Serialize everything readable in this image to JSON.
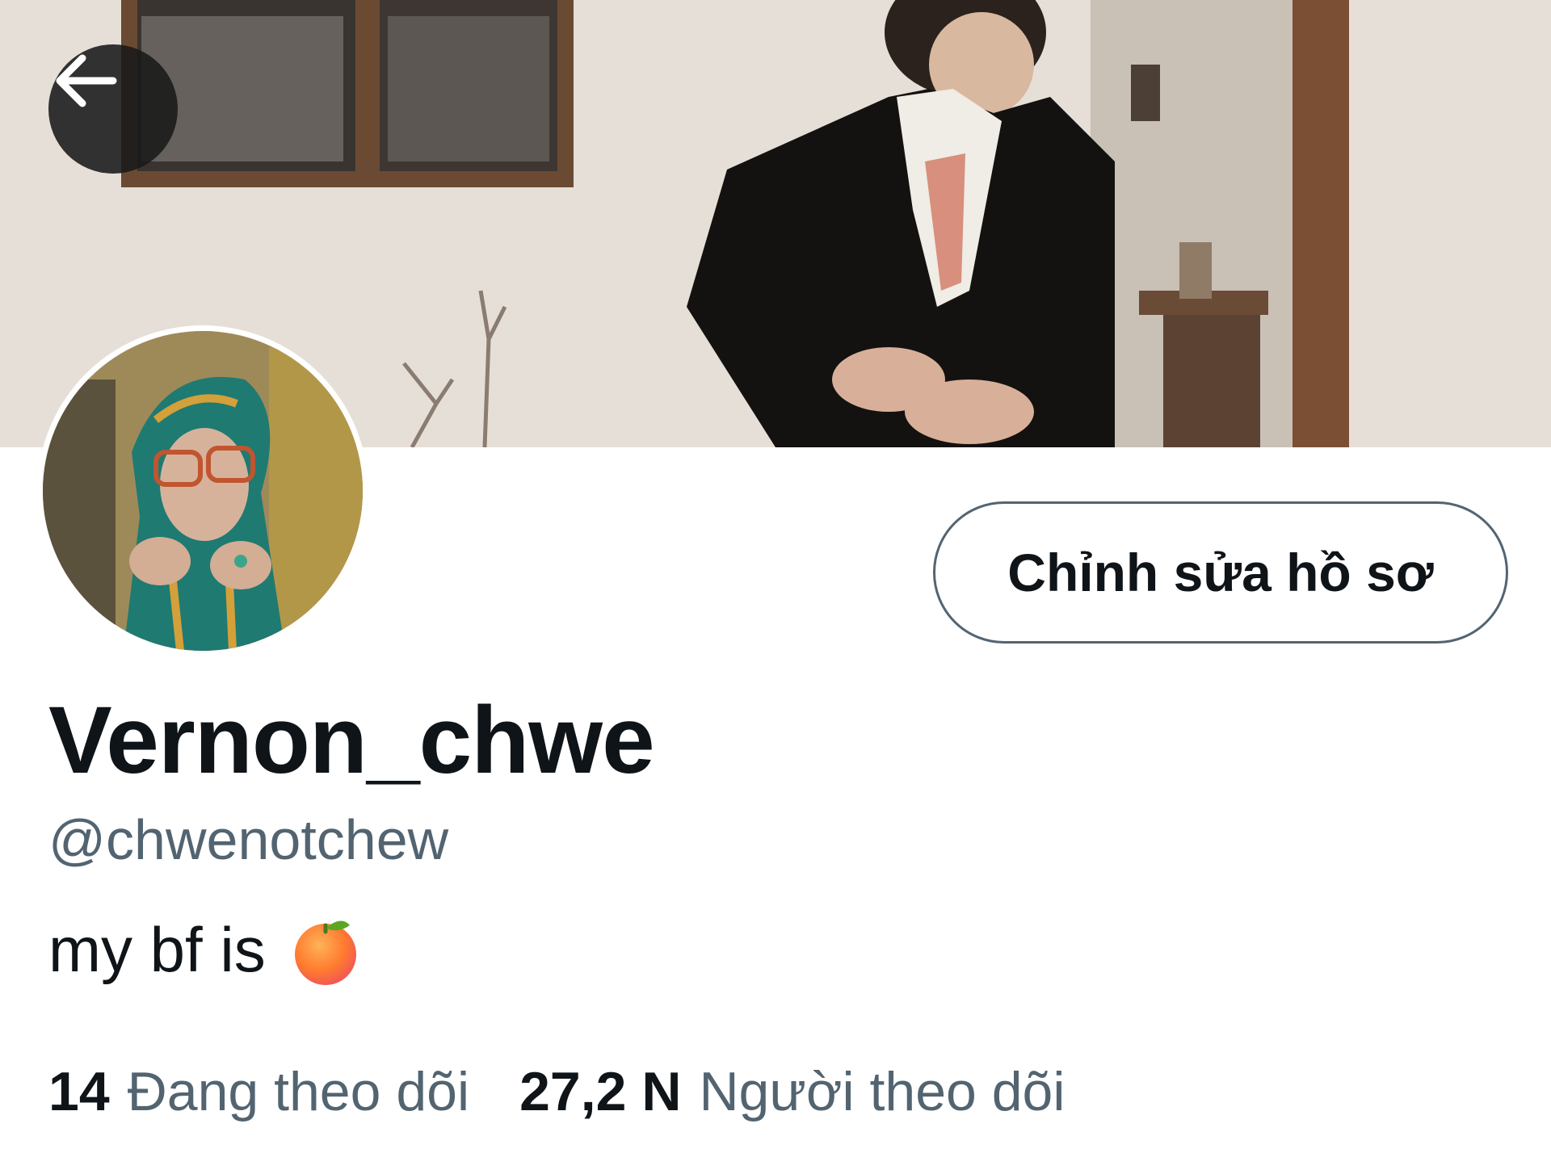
{
  "header": {
    "back_icon": "arrow-left-icon",
    "banner_image": "profile-banner-photo"
  },
  "profile": {
    "avatar_image": "profile-avatar-photo",
    "edit_button_label": "Chỉnh sửa hồ sơ",
    "display_name": "Vernon_chwe",
    "handle": "@chwenotchew",
    "bio_text": "my bf is",
    "bio_emoji": "tangerine-emoji"
  },
  "stats": {
    "following_count": "14",
    "following_label": "Đang theo dõi",
    "followers_count": "27,2 N",
    "followers_label": "Người theo dõi"
  },
  "colors": {
    "primary_text": "#0f1419",
    "secondary_text": "#536471",
    "button_border": "#536471"
  }
}
